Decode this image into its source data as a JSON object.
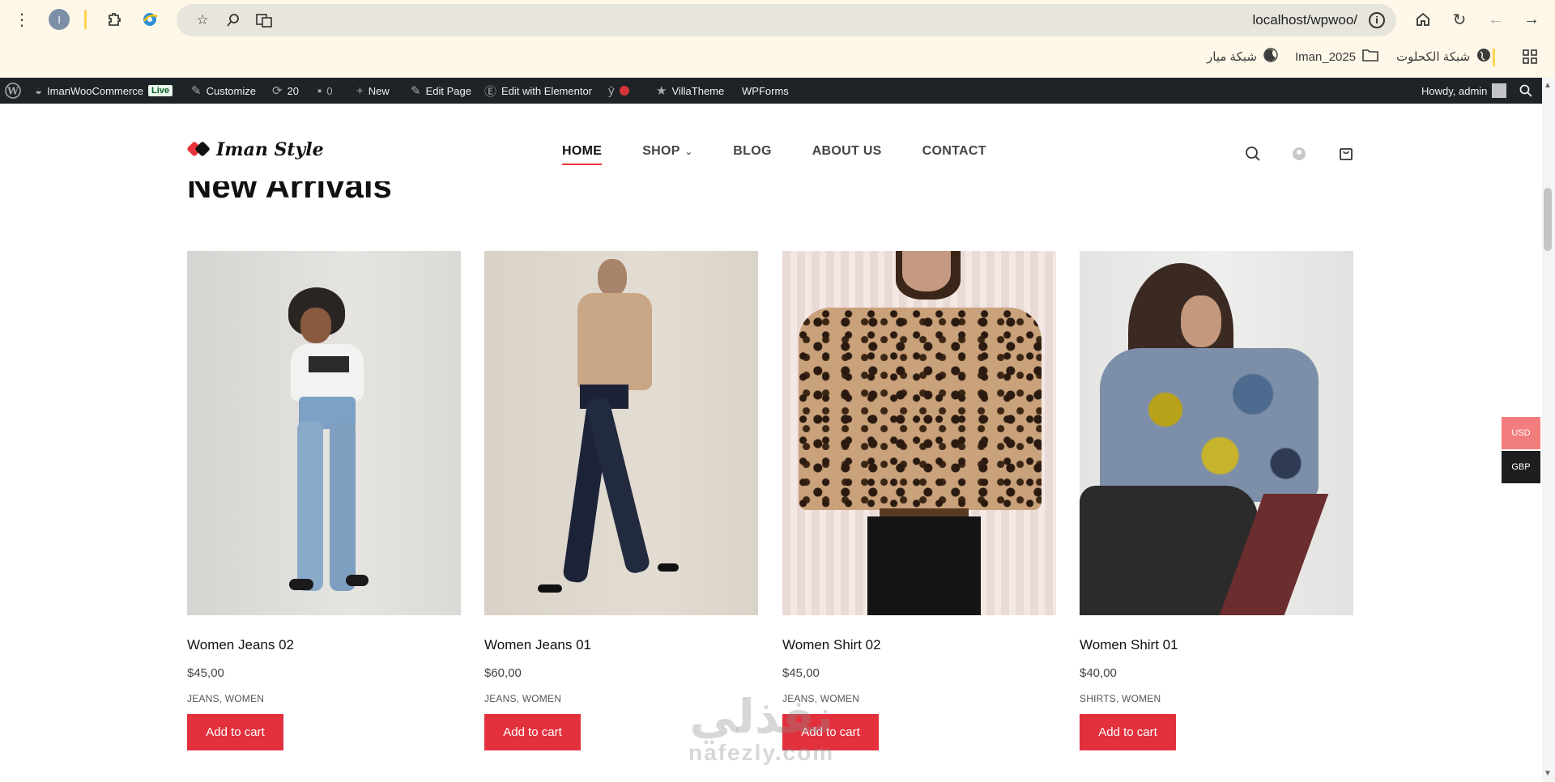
{
  "browser": {
    "url": "localhost/wpwoo/",
    "profile_initial": "I",
    "bookmarks": [
      {
        "label": "شبكة الكحلوت",
        "icon": "globe-icon"
      },
      {
        "label": "Iman_2025",
        "icon": "folder-icon"
      },
      {
        "label": "شبكة ميار",
        "icon": "moon-icon"
      }
    ]
  },
  "adminbar": {
    "site_name": "ImanWooCommerce",
    "live_badge": "Live",
    "customize": "Customize",
    "updates_count": "20",
    "comments_count": "0",
    "new": "New",
    "edit_page": "Edit Page",
    "edit_elementor": "Edit with Elementor",
    "villatheme": "VillaTheme",
    "wpforms": "WPForms",
    "howdy": "Howdy, admin"
  },
  "site": {
    "logo_text": "Iman Style",
    "nav": [
      {
        "label": "HOME",
        "active": true
      },
      {
        "label": "SHOP",
        "has_dropdown": true
      },
      {
        "label": "BLOG"
      },
      {
        "label": "ABOUT US"
      },
      {
        "label": "CONTACT"
      }
    ]
  },
  "section": {
    "title": "New Arrivals"
  },
  "products": [
    {
      "name": "Women Jeans 02",
      "price": "$45,00",
      "categories": "JEANS, WOMEN",
      "button": "Add to cart"
    },
    {
      "name": "Women Jeans 01",
      "price": "$60,00",
      "categories": "JEANS, WOMEN",
      "button": "Add to cart"
    },
    {
      "name": "Women Shirt 02",
      "price": "$45,00",
      "categories": "JEANS, WOMEN",
      "button": "Add to cart"
    },
    {
      "name": "Women Shirt 01",
      "price": "$40,00",
      "categories": "SHIRTS, WOMEN",
      "button": "Add to cart"
    }
  ],
  "currency": {
    "options": [
      "USD",
      "GBP"
    ],
    "colors": {
      "USD": "#f27d7d",
      "GBP": "#1e1e1e"
    }
  },
  "watermark": {
    "arabic": "نفذلي",
    "latin": "nafezly.com"
  },
  "colors": {
    "accent": "#e3303d",
    "adminbar": "#1d2327",
    "chrome": "#fff8e8"
  }
}
